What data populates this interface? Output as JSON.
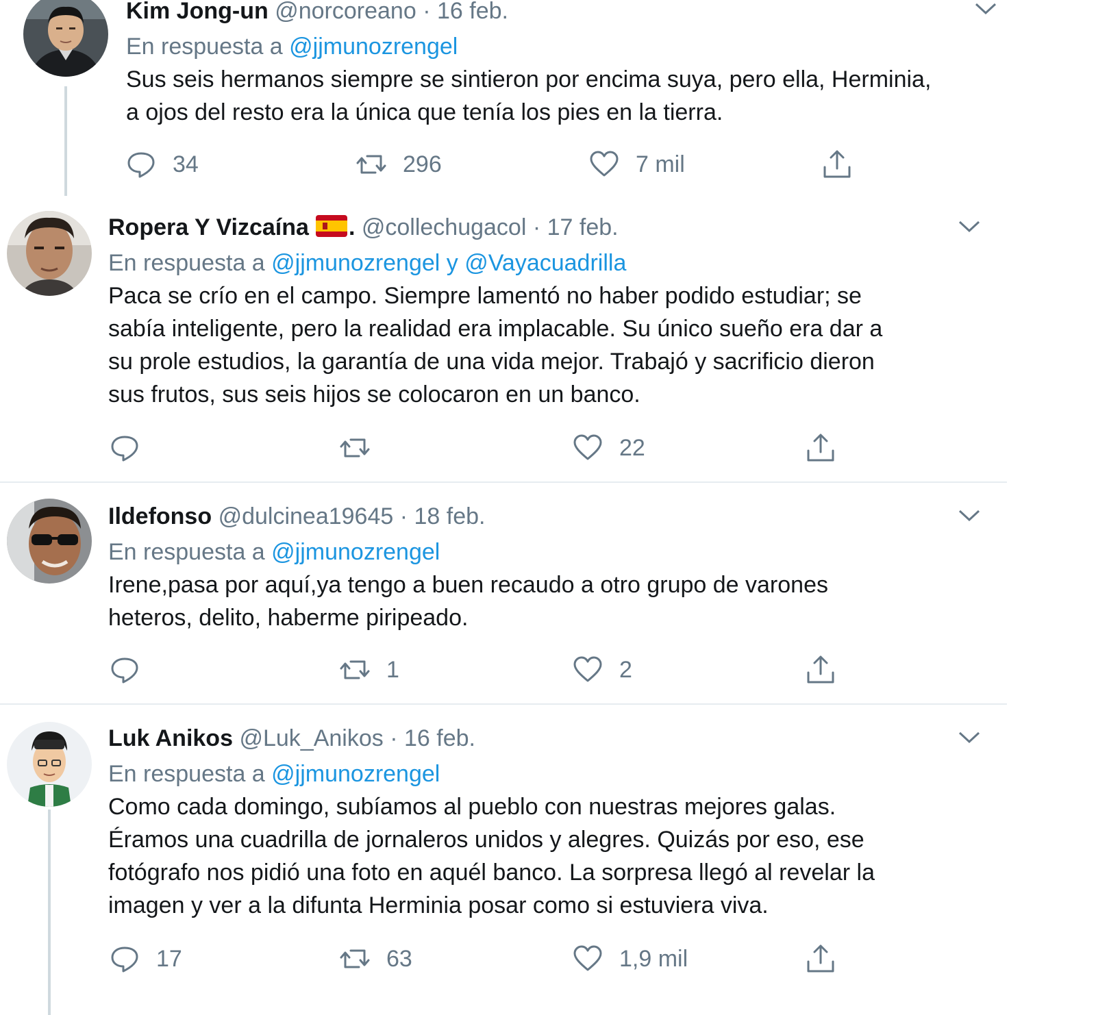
{
  "reply_prefix": "En respuesta a",
  "tweets": [
    {
      "name": "Kim Jong-un",
      "handle": "@norcoreano",
      "separator": "·",
      "date": "16 feb.",
      "reply_mentions": [
        "@jjmunozrengel"
      ],
      "text": "Sus seis hermanos siempre se sintieron por encima suya, pero ella, Herminia,\na ojos del resto era la única que tenía los pies en la tierra.",
      "replies": "34",
      "retweets": "296",
      "likes": "7 mil"
    },
    {
      "name": "Ropera Y Vizcaína",
      "name_suffix": ".",
      "flag": "spain-flag-emoji",
      "handle": "@collechugacol",
      "separator": "·",
      "date": "17 feb.",
      "reply_mentions": [
        "@jjmunozrengel",
        "@Vayacuadrilla"
      ],
      "reply_joiner": "y",
      "text": "Paca se crío en el campo. Siempre lamentó no haber podido estudiar; se\nsabía inteligente, pero la realidad era implacable. Su único sueño era dar a\nsu prole estudios, la garantía de una vida mejor. Trabajó y sacrificio dieron\nsus frutos, sus seis hijos se colocaron en un banco.",
      "replies": "",
      "retweets": "",
      "likes": "22"
    },
    {
      "name": "Ildefonso",
      "handle": "@dulcinea19645",
      "separator": "·",
      "date": "18 feb.",
      "reply_mentions": [
        "@jjmunozrengel"
      ],
      "text": "Irene,pasa por aquí,ya tengo a buen recaudo a otro grupo de varones\nheteros, delito, haberme piripeado.",
      "replies": "",
      "retweets": "1",
      "likes": "2"
    },
    {
      "name": "Luk Anikos",
      "handle": "@Luk_Anikos",
      "separator": "·",
      "date": "16 feb.",
      "reply_mentions": [
        "@jjmunozrengel"
      ],
      "text": "Como cada domingo, subíamos al pueblo con nuestras mejores galas.\nÉramos una cuadrilla de jornaleros unidos y alegres. Quizás por eso, ese\nfotógrafo nos pidió una foto en aquél banco. La sorpresa llegó al revelar la\nimagen y ver a la difunta Herminia posar como si estuviera viva.",
      "replies": "17",
      "retweets": "63",
      "likes": "1,9 mil"
    }
  ],
  "icons": {
    "reply": "reply-icon",
    "retweet": "retweet-icon",
    "like": "heart-icon",
    "share": "share-icon",
    "menu": "chevron-down-icon"
  },
  "colors": {
    "text": "#14171a",
    "secondary": "#657786",
    "mention": "#1b95e0",
    "divider": "#e6ecf0",
    "thread_line": "#cfd9de"
  }
}
